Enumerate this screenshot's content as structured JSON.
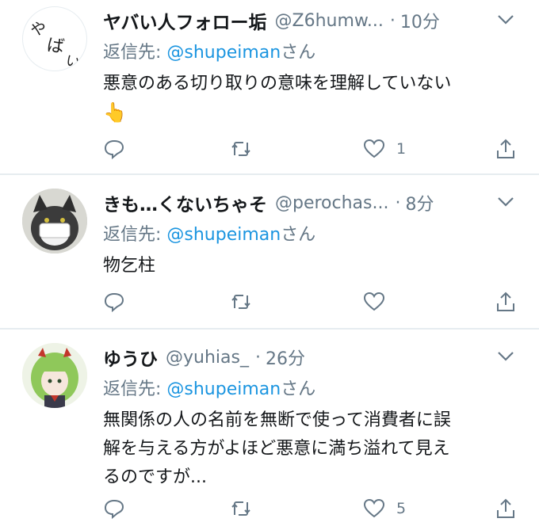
{
  "tweets": [
    {
      "name": "ヤバい人フォロー垢",
      "handle": "@Z6humw...",
      "time": "10分",
      "reply_prefix": "返信先: ",
      "reply_to": "@shupeiman",
      "reply_suffix": "さん",
      "text": "悪意のある切り取りの意味を理解していない",
      "emoji": "👆",
      "likes": "1",
      "avatar_text": "やばい"
    },
    {
      "name": "きも…くないちゃそ",
      "handle": "@perochas...",
      "time": "8分",
      "reply_prefix": "返信先: ",
      "reply_to": "@shupeiman",
      "reply_suffix": "さん",
      "text": "物乞柱",
      "likes": ""
    },
    {
      "name": "ゆうひ",
      "handle": "@yuhias_",
      "time": "26分",
      "reply_prefix": "返信先: ",
      "reply_to": "@shupeiman",
      "reply_suffix": "さん",
      "text_lines": [
        "無関係の人の名前を無断で使って消費者に誤",
        "解を与える方がよほど悪意に満ち溢れて見え",
        "るのですが..."
      ],
      "likes": "5"
    }
  ],
  "separator": "·",
  "icons": [
    "reply-icon",
    "retweet-icon",
    "like-icon",
    "share-icon",
    "chevron-down-icon"
  ],
  "colors": {
    "mention": "#1b95e0",
    "secondary": "#657786",
    "divider": "#e6ecf0"
  }
}
